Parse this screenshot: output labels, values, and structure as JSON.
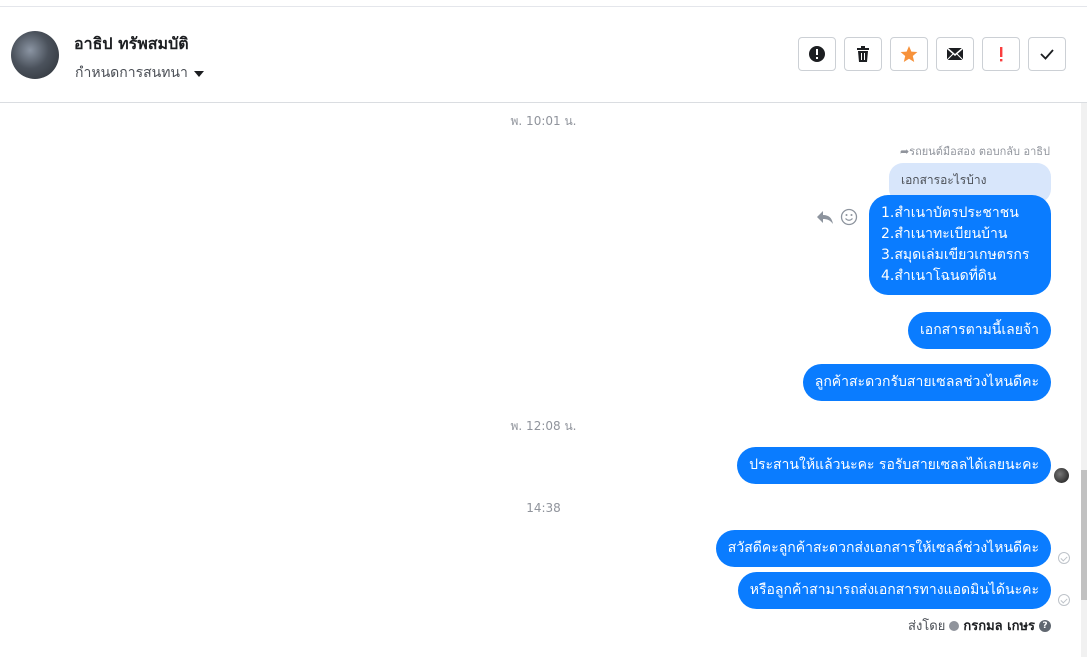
{
  "header": {
    "contact_name": "อาธิป ทรัพสมบัติ",
    "assign_label": "กำหนดการสนทนา",
    "actions": [
      {
        "name": "spam-button",
        "icon": "alert-circle-icon"
      },
      {
        "name": "delete-button",
        "icon": "trash-icon"
      },
      {
        "name": "star-button",
        "icon": "star-icon"
      },
      {
        "name": "mark-unread-button",
        "icon": "envelope-icon"
      },
      {
        "name": "follow-up-button",
        "icon": "exclamation-icon"
      },
      {
        "name": "done-button",
        "icon": "check-icon"
      }
    ]
  },
  "conversation": {
    "timestamps": {
      "t1": "พ. 10:01 น.",
      "t2": "พ. 12:08 น.",
      "t3": "14:38"
    },
    "reply_note": "รถยนต์มือสอง ตอบกลับ อาธิป",
    "quoted_text": "เอกสารอะไรบ้าง",
    "messages": {
      "m1": [
        "1.สำเนาบัตรประชาชน",
        "2.สำเนาทะเบียนบ้าน",
        "3.สมุดเล่มเขียวเกษตรกร",
        "4.สำเนาโฉนดที่ดิน"
      ],
      "m2": "เอกสารตามนี้เลยจ้า",
      "m3": "ลูกค้าสะดวกรับสายเซลลช่วงไหนดีคะ",
      "m4": "ประสานให้แล้วนะคะ รอรับสายเซลลได้เลยนะคะ",
      "m5": "สวัสดีคะลูกค้าสะดวกส่งเอกสารให้เซลล์ช่วงไหนดีคะ",
      "m6": "หรือลูกค้าสามารถส่งเอกสารทางแอดมินได้นะคะ"
    },
    "sent_by_label": "ส่งโดย",
    "sent_by_name": "กรกมล เกษร"
  },
  "colors": {
    "bubble": "#0a7cff",
    "quoted_bg": "#d8e6fb",
    "star": "#f7923b",
    "alert": "#fa3e3e"
  }
}
